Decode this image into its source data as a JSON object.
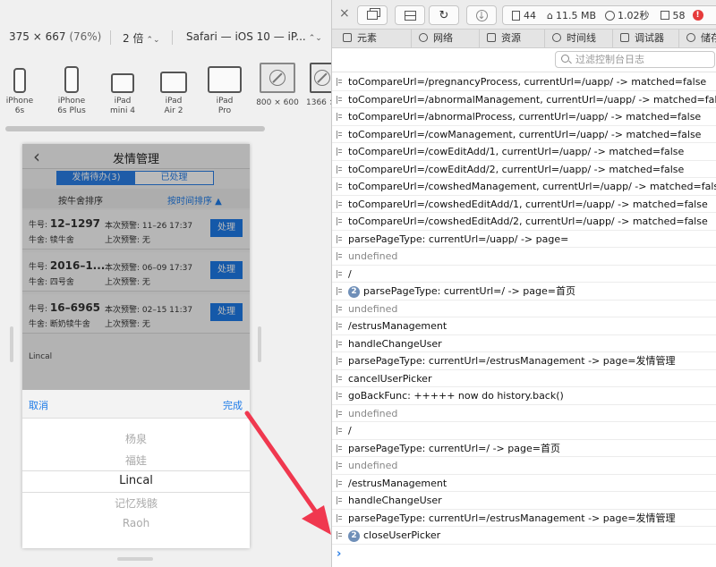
{
  "rdm": {
    "size": "375 × 667",
    "zoom_pct": "(76%)",
    "scale": "2 倍",
    "agent": "Safari — iOS 10 — iP...",
    "devices": [
      {
        "name": "iPhone\n6s"
      },
      {
        "name": "iPhone\n6s Plus"
      },
      {
        "name": "iPad\nmini 4"
      },
      {
        "name": "iPad\nAir 2"
      },
      {
        "name": "iPad\nPro"
      },
      {
        "name": "800 × 600"
      },
      {
        "name": "1366 ×"
      }
    ]
  },
  "app": {
    "nav_title": "发情管理",
    "back_icon": "chevron-left-icon",
    "tabs": [
      "发情待办(3)",
      "已处理"
    ],
    "sort_left": "按牛舍排序",
    "sort_right": "按时间排序 ▲",
    "cards": [
      {
        "cow_label": "牛号:",
        "cow_no": "12–1297",
        "barn_label": "牛舍:",
        "barn": "犊牛舍",
        "this_label": "本次预警:",
        "this_val": "11–26 17:37",
        "last_label": "上次预警:",
        "last_val": "无",
        "button": "处理"
      },
      {
        "cow_label": "牛号:",
        "cow_no": "2016–1...",
        "barn_label": "牛舍:",
        "barn": "四号舍",
        "this_label": "本次预警:",
        "this_val": "06–09 17:37",
        "last_label": "上次预警:",
        "last_val": "无",
        "button": "处理"
      },
      {
        "cow_label": "牛号:",
        "cow_no": "16–6965",
        "barn_label": "牛舍:",
        "barn": "断奶犊牛舍",
        "this_label": "本次预警:",
        "this_val": "02–15 11:37",
        "last_label": "上次预警:",
        "last_val": "无",
        "button": "处理"
      }
    ],
    "selected_user": "Lincal",
    "picker": {
      "cancel": "取消",
      "done": "完成",
      "options": [
        "杨泉",
        "福娃",
        "Lincal",
        "记忆残骸",
        "Raoh"
      ],
      "selected_index": 2
    }
  },
  "inspector": {
    "close_icon": "close-icon",
    "resource_count": "44",
    "memory": "11.5 MB",
    "load_time": "1.02秒",
    "message_count": "58",
    "error_badge": "!",
    "tabs": [
      "元素",
      "网络",
      "资源",
      "时间线",
      "调试器",
      "储存"
    ],
    "filter_placeholder": "过滤控制台日志",
    "logs": [
      {
        "text": "toCompareUrl=/pregnancyProcess, currentUrl=/uapp/ -> matched=false"
      },
      {
        "text": "toCompareUrl=/abnormalManagement, currentUrl=/uapp/ -> matched=false"
      },
      {
        "text": "toCompareUrl=/abnormalProcess, currentUrl=/uapp/ -> matched=false"
      },
      {
        "text": "toCompareUrl=/cowManagement, currentUrl=/uapp/ -> matched=false"
      },
      {
        "text": "toCompareUrl=/cowEditAdd/1, currentUrl=/uapp/ -> matched=false"
      },
      {
        "text": "toCompareUrl=/cowEditAdd/2, currentUrl=/uapp/ -> matched=false"
      },
      {
        "text": "toCompareUrl=/cowshedManagement, currentUrl=/uapp/ -> matched=false"
      },
      {
        "text": "toCompareUrl=/cowshedEditAdd/1, currentUrl=/uapp/ -> matched=false"
      },
      {
        "text": "toCompareUrl=/cowshedEditAdd/2, currentUrl=/uapp/ -> matched=false"
      },
      {
        "text": "parsePageType: currentUrl=/uapp/ -> page="
      },
      {
        "text": "undefined",
        "undef": true
      },
      {
        "text": "/"
      },
      {
        "text": "parsePageType: currentUrl=/ -> page=首页",
        "repeat": "2"
      },
      {
        "text": "undefined",
        "undef": true
      },
      {
        "text": "/estrusManagement"
      },
      {
        "text": "handleChangeUser"
      },
      {
        "text": "parsePageType: currentUrl=/estrusManagement -> page=发情管理"
      },
      {
        "text": "cancelUserPicker"
      },
      {
        "text": "goBackFunc: +++++ now do history.back()"
      },
      {
        "text": "undefined",
        "undef": true
      },
      {
        "text": "/"
      },
      {
        "text": "parsePageType: currentUrl=/ -> page=首页"
      },
      {
        "text": "undefined",
        "undef": true
      },
      {
        "text": "/estrusManagement"
      },
      {
        "text": "handleChangeUser"
      },
      {
        "text": "parsePageType: currentUrl=/estrusManagement -> page=发情管理"
      },
      {
        "text": "closeUserPicker",
        "repeat": "2"
      }
    ],
    "prompt_symbol": "›"
  },
  "colors": {
    "accent": "#2a7ee6",
    "arrow": "#f0384f"
  }
}
